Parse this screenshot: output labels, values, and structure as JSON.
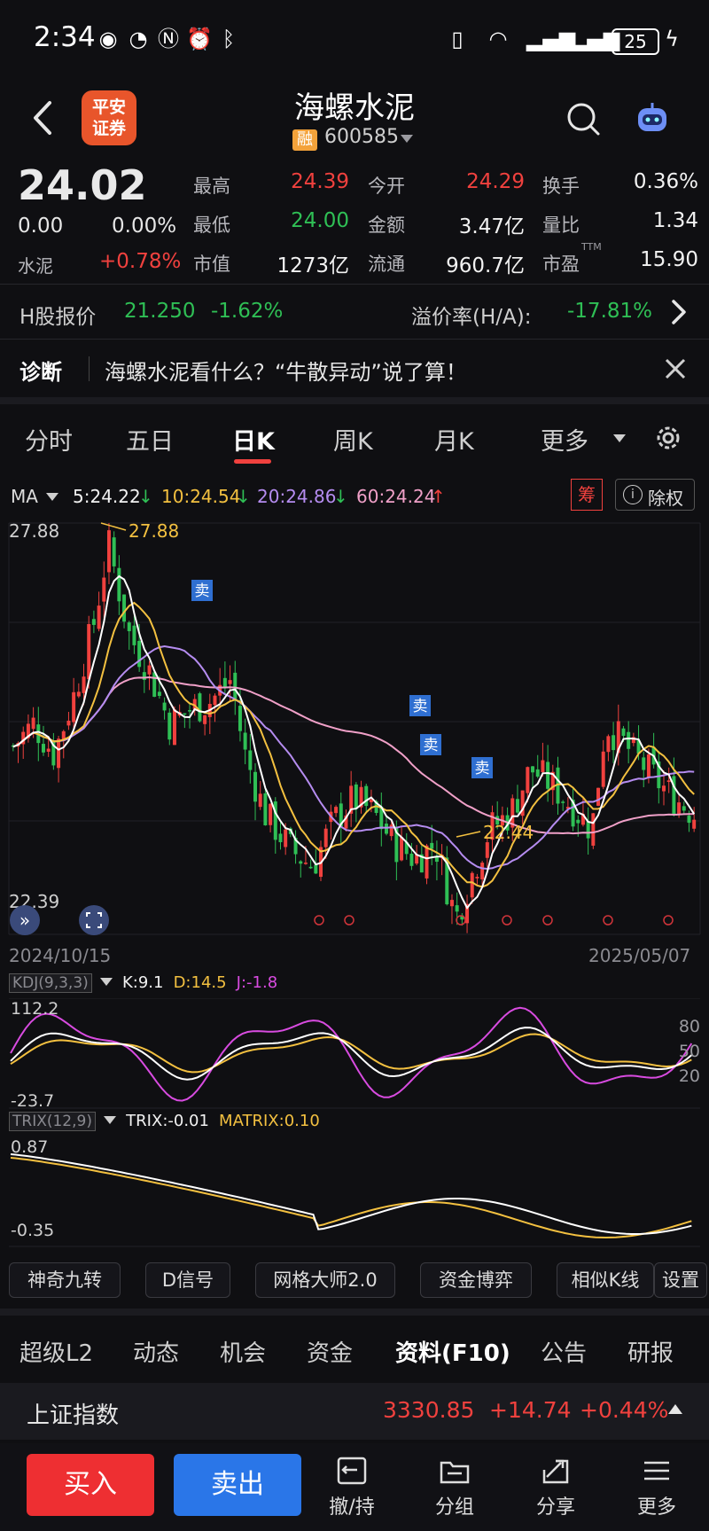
{
  "status_bar": {
    "time": "2:34",
    "battery": "25"
  },
  "header": {
    "broker_logo": "平安\n证券",
    "stock_name": "海螺水泥",
    "margin_badge": "融",
    "stock_code": "600585"
  },
  "quote": {
    "price": "24.02",
    "change": "0.00",
    "change_pct": "0.00%",
    "sector": "水泥",
    "sector_change": "+0.78%",
    "fields": [
      {
        "label": "最高",
        "value": "24.39",
        "color": "red"
      },
      {
        "label": "今开",
        "value": "24.29",
        "color": "red"
      },
      {
        "label": "换手",
        "value": "0.36%",
        "color": "white"
      },
      {
        "label": "最低",
        "value": "24.00",
        "color": "green"
      },
      {
        "label": "金额",
        "value": "3.47亿",
        "color": "white"
      },
      {
        "label": "量比",
        "value": "1.34",
        "color": "white"
      },
      {
        "label": "市值",
        "value": "1273亿",
        "color": "white"
      },
      {
        "label": "流通",
        "value": "960.7亿",
        "color": "white"
      },
      {
        "label": "市盈",
        "value": "15.90",
        "color": "white",
        "sup": "TTM"
      }
    ]
  },
  "h_share": {
    "label": "H股报价",
    "price": "21.250",
    "change_pct": "-1.62%",
    "premium_label": "溢价率(H/A):",
    "premium_value": "-17.81%"
  },
  "diagnose": {
    "label": "诊断",
    "text": "海螺水泥看什么？“牛散异动”说了算！"
  },
  "tabs": [
    "分时",
    "五日",
    "日K",
    "周K",
    "月K",
    "更多"
  ],
  "active_tab": "日K",
  "ma_legend": {
    "label": "MA",
    "ma5": "5:24.22",
    "ma10": "10:24.54",
    "ma20": "20:24.86",
    "ma60": "60:24.24",
    "chip_label": "筹",
    "adjust_label": "除权"
  },
  "chart_data": {
    "type": "candlestick",
    "y_top_label": "27.88",
    "y_bottom_label": "22.39",
    "high_annotation": "27.88",
    "low_annotation": "22.44",
    "x_start": "2024/10/15",
    "x_end": "2025/05/07",
    "sell_signal_label": "卖",
    "ylim": [
      22.39,
      27.88
    ],
    "colors": {
      "up": "#f0413e",
      "down": "#2fbf55",
      "ma5": "#ffffff",
      "ma10": "#f3c040",
      "ma20": "#b58cf0",
      "ma60": "#f0a0c8"
    }
  },
  "kdj": {
    "title": "KDJ(9,3,3)",
    "k": "K:9.1",
    "d": "D:14.5",
    "j": "J:-1.8",
    "y_top": "112.2",
    "y_bottom": "-23.7",
    "levels": [
      "80",
      "50",
      "20"
    ]
  },
  "trix": {
    "title": "TRIX(12,9)",
    "trix": "TRIX:-0.01",
    "matrix": "MATRIX:0.10",
    "y_top": "0.87",
    "y_bottom": "-0.35"
  },
  "tools": [
    "神奇九转",
    "D信号",
    "网格大师2.0",
    "资金博弈",
    "相似K线",
    "设置"
  ],
  "bottom_tabs": [
    "超级L2",
    "动态",
    "机会",
    "资金",
    "资料(F10)",
    "公告",
    "研报"
  ],
  "index_bar": {
    "name": "上证指数",
    "value": "3330.85",
    "change": "+14.74",
    "change_pct": "+0.44%"
  },
  "actions": {
    "buy": "买入",
    "sell": "卖出",
    "items": [
      "撤/持",
      "分组",
      "分享",
      "更多"
    ]
  }
}
